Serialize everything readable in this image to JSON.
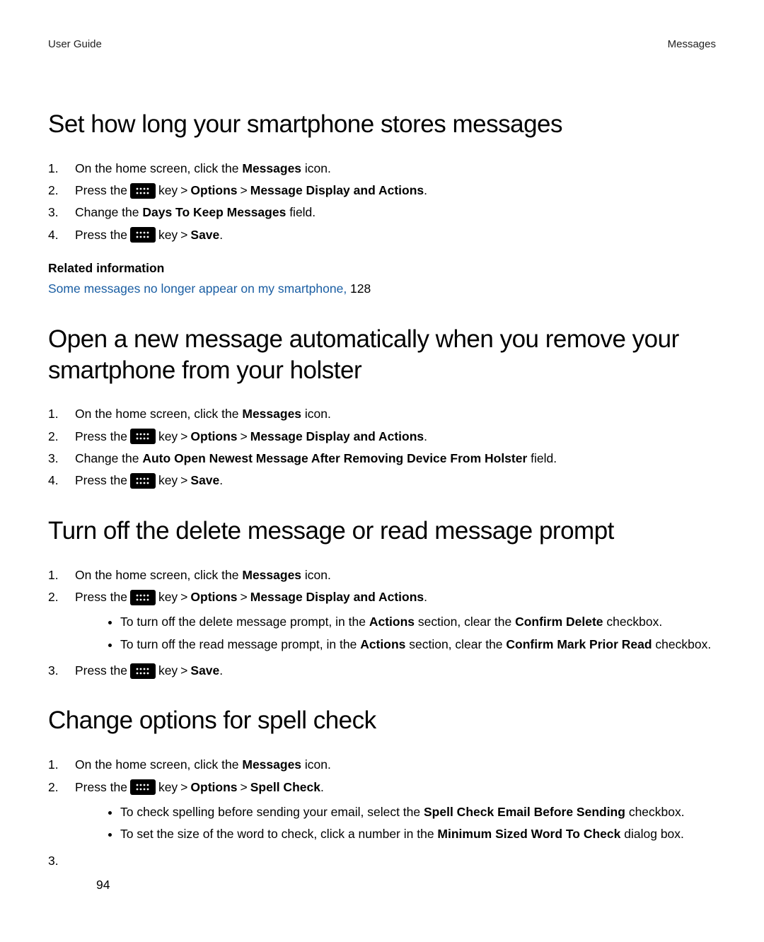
{
  "header": {
    "left": "User Guide",
    "right": "Messages"
  },
  "page_number": "94",
  "common": {
    "press_the": "Press the ",
    "key": " key ",
    "gt": ">",
    "period": ".",
    "on_home_click": "On the home screen, click the ",
    "messages": "Messages",
    "icon": " icon.",
    "options": "Options",
    "msg_disp_actions": "Message Display and Actions",
    "save": "Save",
    "change_the": "Change the ",
    "field": " field."
  },
  "section1": {
    "heading": "Set how long your smartphone stores messages",
    "step3_bold": "Days To Keep Messages",
    "rel_title": "Related information",
    "rel_link_text": "Some messages no longer appear on my smartphone,",
    "rel_link_page": " 128"
  },
  "section2": {
    "heading": "Open a new message automatically when you remove your smartphone from your holster",
    "step3_bold": "Auto Open Newest Message After Removing Device From Holster"
  },
  "section3": {
    "heading": "Turn off the delete message or read message prompt",
    "sub1_a": "To turn off the delete message prompt, in the ",
    "sub1_b": "Actions",
    "sub1_c": " section, clear the ",
    "sub1_d": "Confirm Delete",
    "sub1_e": " checkbox.",
    "sub2_a": "To turn off the read message prompt, in the ",
    "sub2_b": "Actions",
    "sub2_c": " section, clear the ",
    "sub2_d": "Confirm Mark Prior Read",
    "sub2_e": " checkbox."
  },
  "section4": {
    "heading": "Change options for spell check",
    "spell_check": "Spell Check",
    "sub1_a": "To check spelling before sending your email, select the ",
    "sub1_b": "Spell Check Email Before Sending",
    "sub1_c": " checkbox.",
    "sub2_a": "To set the size of the word to check, click a number in the ",
    "sub2_b": "Minimum Sized Word To Check",
    "sub2_c": " dialog box."
  },
  "nums": {
    "n1": "1.",
    "n2": "2.",
    "n3": "3.",
    "n4": "4."
  }
}
